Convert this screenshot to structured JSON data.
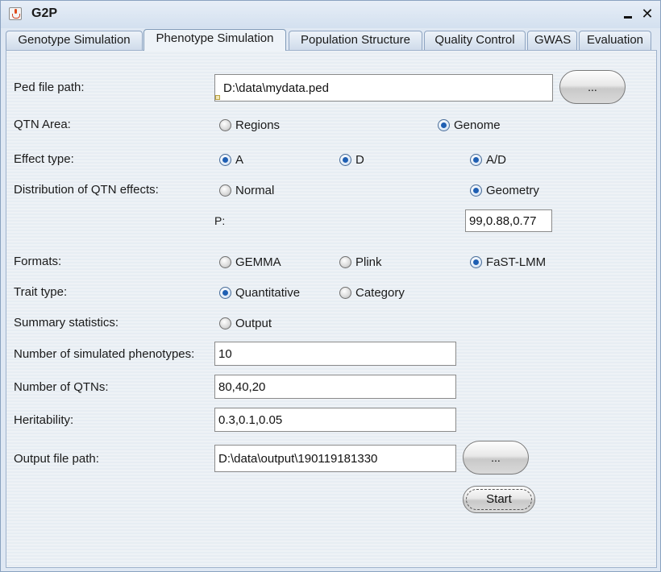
{
  "window": {
    "title": "G2P"
  },
  "tabs": [
    {
      "label": "Genotype Simulation"
    },
    {
      "label": "Phenotype Simulation"
    },
    {
      "label": "Population Structure"
    },
    {
      "label": "Quality Control"
    },
    {
      "label": "GWAS"
    },
    {
      "label": "Evaluation"
    }
  ],
  "active_tab": "Phenotype Simulation",
  "form": {
    "ped_label": "Ped file path:",
    "ped_value": "D:\\data\\mydata.ped",
    "browse_label": "...",
    "qtn_area": {
      "label": "QTN Area:",
      "options": [
        "Regions",
        "Genome"
      ],
      "selected": "Genome"
    },
    "effect_type": {
      "label": "Effect type:",
      "options": [
        "A",
        "D",
        "A/D"
      ],
      "selected": [
        "A",
        "D",
        "A/D"
      ]
    },
    "distribution": {
      "label": "Distribution of QTN effects:",
      "options": [
        "Normal",
        "Geometry"
      ],
      "selected": "Geometry"
    },
    "p_label": "P:",
    "p_value": "99,0.88,0.77",
    "formats": {
      "label": "Formats:",
      "options": [
        "GEMMA",
        "Plink",
        "FaST-LMM"
      ],
      "selected": "FaST-LMM"
    },
    "trait_type": {
      "label": "Trait type:",
      "options": [
        "Quantitative",
        "Category"
      ],
      "selected": "Quantitative"
    },
    "summary": {
      "label": "Summary statistics:",
      "options": [
        "Output"
      ],
      "selected": ""
    },
    "num_pheno_label": "Number of simulated phenotypes:",
    "num_pheno_value": "10",
    "num_qtn_label": "Number of QTNs:",
    "num_qtn_value": "80,40,20",
    "heritability_label": "Heritability:",
    "heritability_value": "0.3,0.1,0.05",
    "output_label": "Output file path:",
    "output_value": "D:\\data\\output\\190119181330",
    "output_browse_label": "...",
    "start_label": "Start"
  }
}
